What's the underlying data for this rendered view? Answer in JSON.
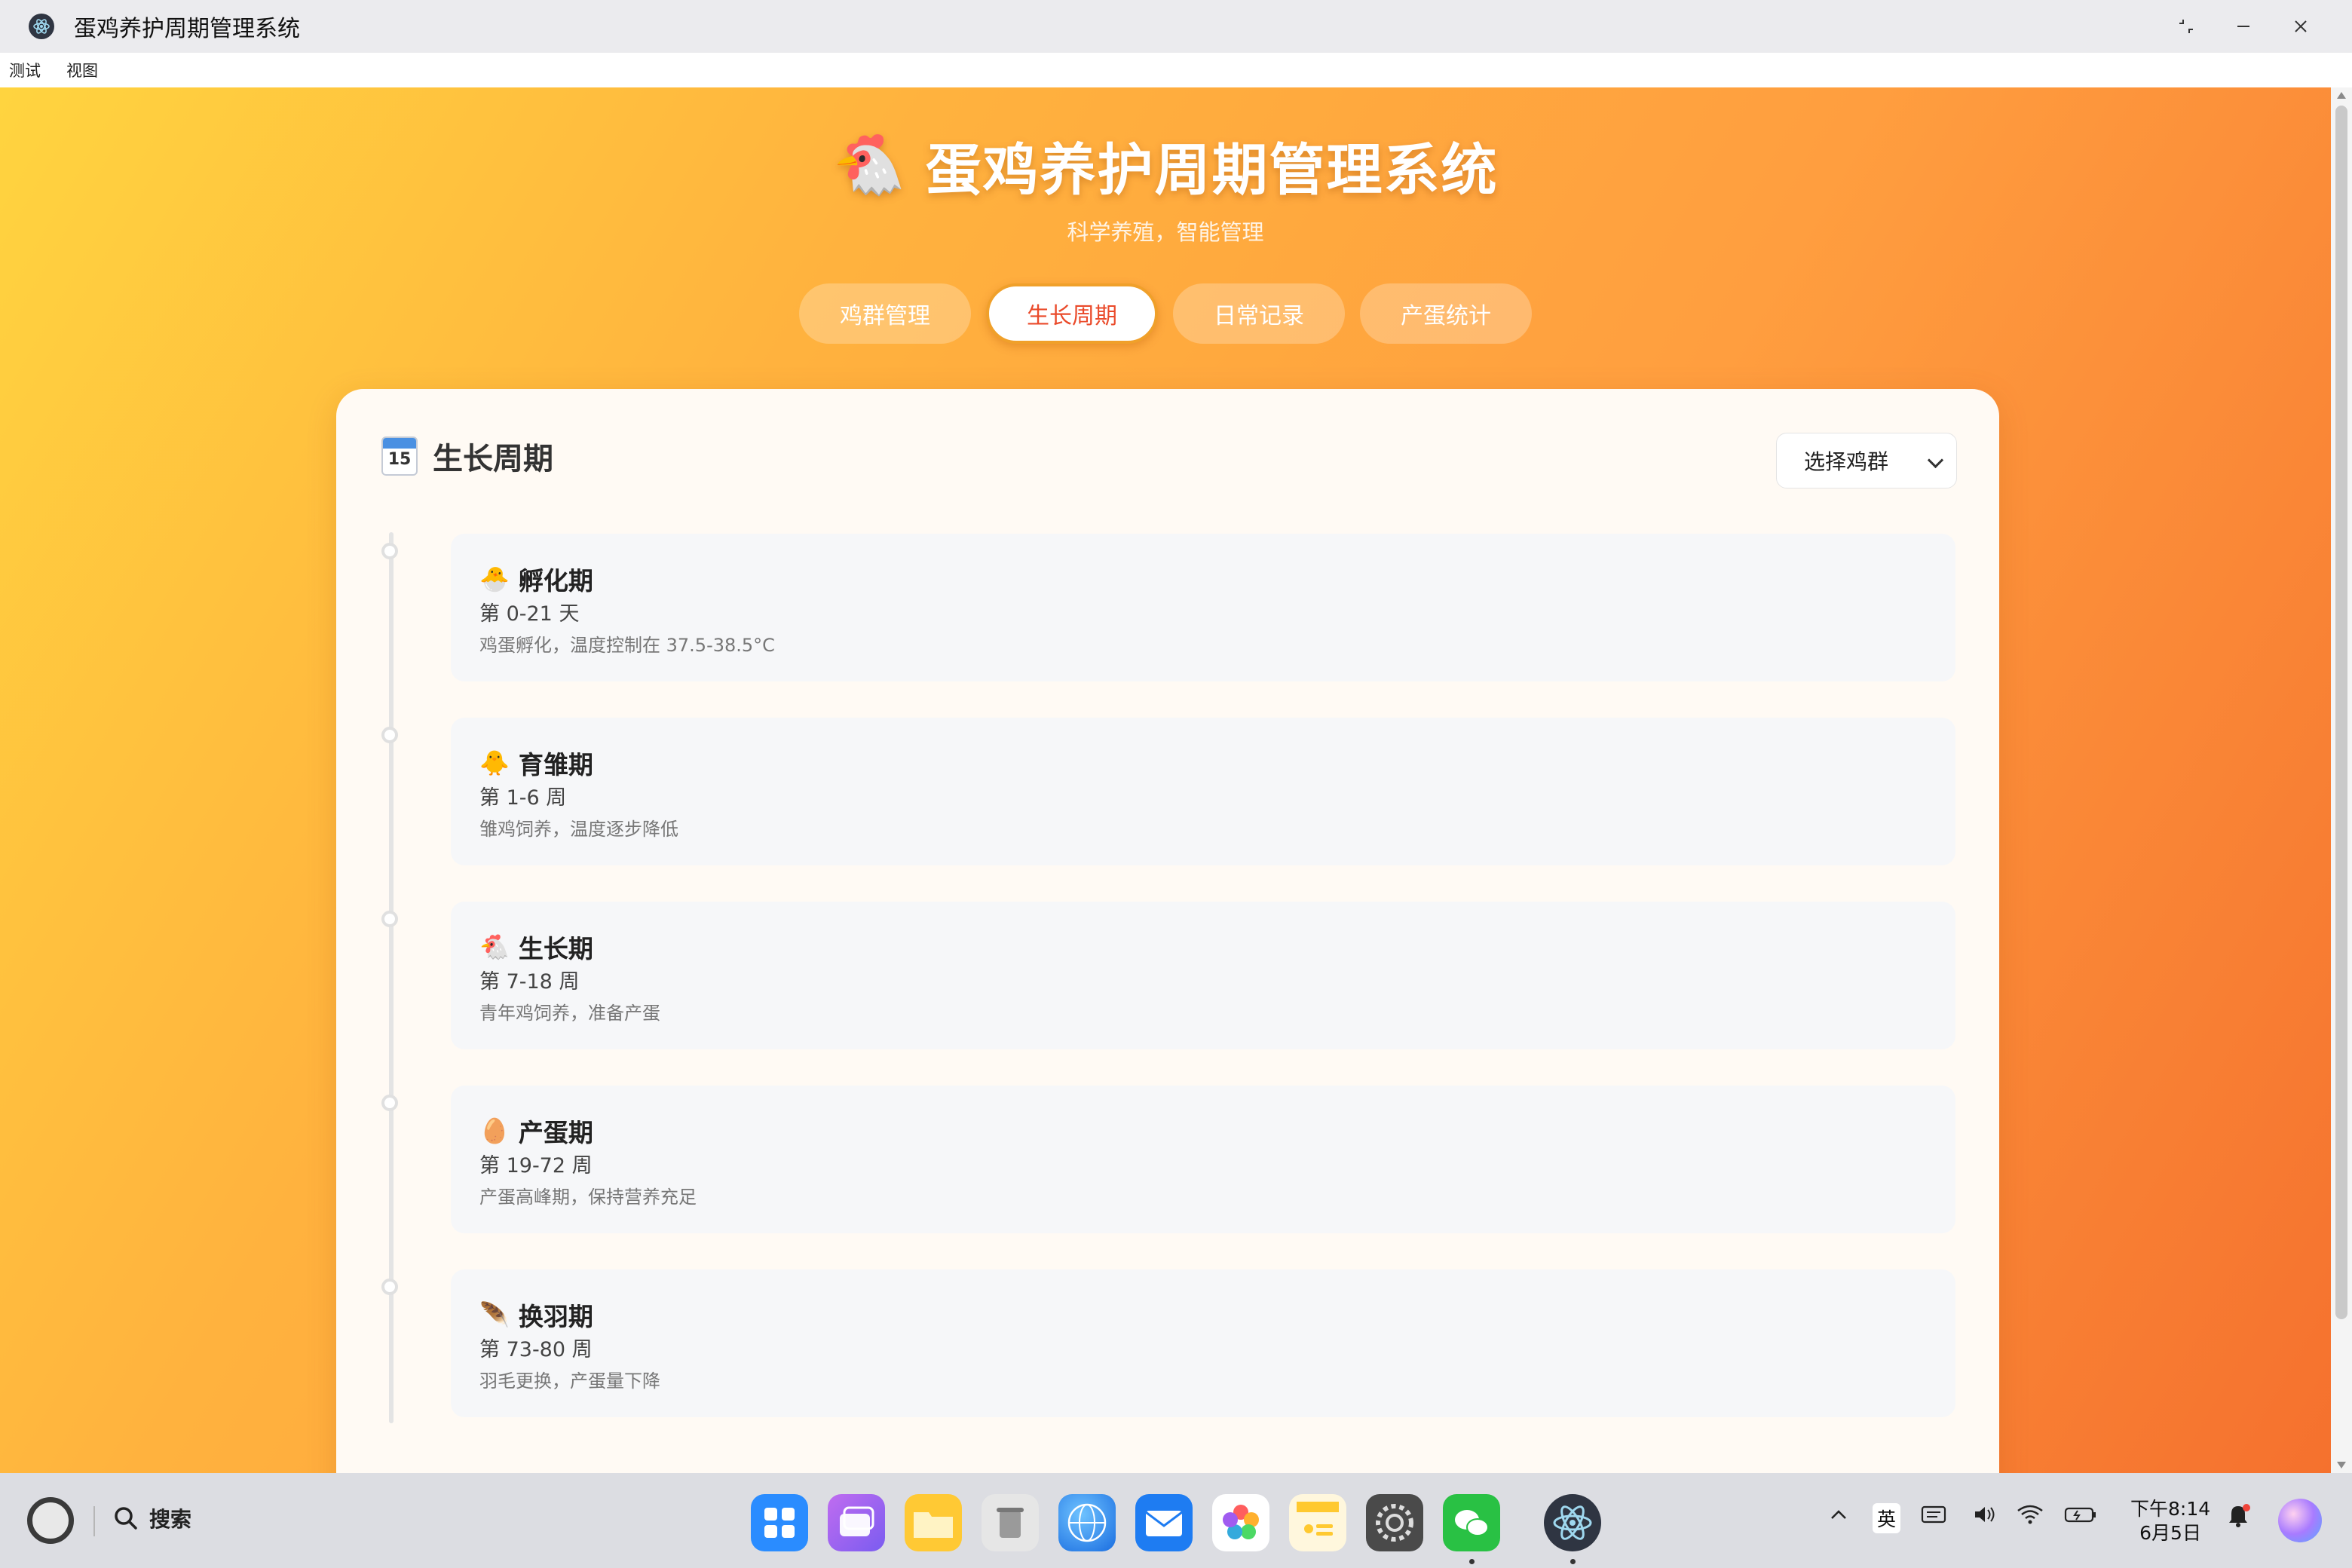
{
  "window": {
    "title": "蛋鸡养护周期管理系统"
  },
  "menu": {
    "items": [
      "测试",
      "视图"
    ]
  },
  "app": {
    "title_emoji": "🐔",
    "title": "蛋鸡养护周期管理系统",
    "subtitle": "科学养殖，智能管理",
    "tabs": [
      {
        "label": "鸡群管理",
        "active": false
      },
      {
        "label": "生长周期",
        "active": true
      },
      {
        "label": "日常记录",
        "active": false
      },
      {
        "label": "产蛋统计",
        "active": false
      }
    ]
  },
  "card": {
    "icon": "calendar-icon",
    "icon_text": "15",
    "title": "生长周期",
    "select": {
      "value": "选择鸡群"
    },
    "stages": [
      {
        "emoji": "🐣",
        "name": "孵化期",
        "period": "第 0-21 天",
        "desc": "鸡蛋孵化，温度控制在 37.5-38.5°C"
      },
      {
        "emoji": "🐥",
        "name": "育雏期",
        "period": "第 1-6 周",
        "desc": "雏鸡饲养，温度逐步降低"
      },
      {
        "emoji": "🐔",
        "name": "生长期",
        "period": "第 7-18 周",
        "desc": "青年鸡饲养，准备产蛋"
      },
      {
        "emoji": "🥚",
        "name": "产蛋期",
        "period": "第 19-72 周",
        "desc": "产蛋高峰期，保持营养充足"
      },
      {
        "emoji": "🪶",
        "name": "换羽期",
        "period": "第 73-80 周",
        "desc": "羽毛更换，产蛋量下降"
      }
    ]
  },
  "taskbar": {
    "search_label": "搜索",
    "ime_label": "英",
    "time": "下午8:14",
    "date": "6月5日"
  },
  "colors": {
    "accent_red": "#ea4a2a",
    "gradient_start": "#ffd43f",
    "gradient_end": "#f5712e"
  }
}
